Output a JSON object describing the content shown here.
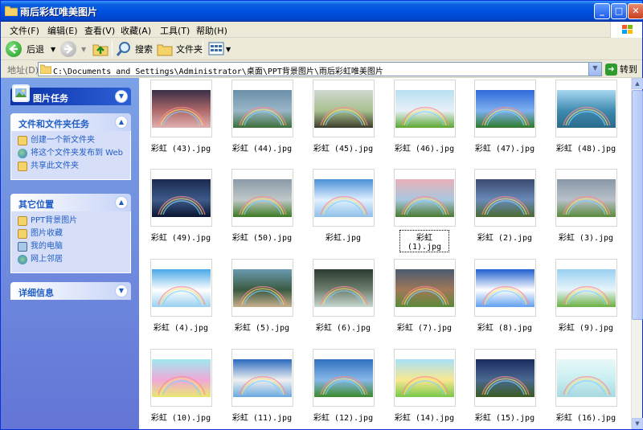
{
  "window": {
    "title": "雨后彩虹唯美图片"
  },
  "window_buttons": {
    "minimize": "_",
    "maximize": "□",
    "close": "✕"
  },
  "menu": [
    "文件(F)",
    "编辑(E)",
    "查看(V)",
    "收藏(A)",
    "工具(T)",
    "帮助(H)"
  ],
  "toolbar": {
    "back": "后退",
    "search": "搜索",
    "folders": "文件夹"
  },
  "address": {
    "label": "地址(D)",
    "path": "C:\\Documents and Settings\\Administrator\\桌面\\PPT背景图片\\雨后彩虹唯美图片",
    "go": "转到"
  },
  "leftpane": {
    "picture_tasks": "图片任务",
    "file_tasks": {
      "title": "文件和文件夹任务",
      "items": [
        "创建一个新文件夹",
        "将这个文件夹发布到 Web",
        "共享此文件夹"
      ]
    },
    "other_places": {
      "title": "其它位置",
      "items": [
        "PPT背景图片",
        "图片收藏",
        "我的电脑",
        "网上邻居"
      ]
    },
    "details": "详细信息"
  },
  "files": [
    {
      "name": "彩虹 (43).jpg",
      "colors": [
        "#3a2e48",
        "#b06a6a",
        "#e0b0b0"
      ]
    },
    {
      "name": "彩虹 (44).jpg",
      "colors": [
        "#6a8fa8",
        "#9ab6c8",
        "#3c6e38"
      ]
    },
    {
      "name": "彩虹 (45).jpg",
      "colors": [
        "#cfd8d0",
        "#a8c090",
        "#3d3d2a"
      ]
    },
    {
      "name": "彩虹 (46).jpg",
      "colors": [
        "#b8e0f0",
        "#e8f0f8",
        "#5aa830"
      ]
    },
    {
      "name": "彩虹 (47).jpg",
      "colors": [
        "#2f6ad8",
        "#7fb0f0",
        "#2e7a28"
      ]
    },
    {
      "name": "彩虹 (48).jpg",
      "colors": [
        "#a8d8f0",
        "#3e8ab0",
        "#2a6a8a"
      ]
    },
    {
      "name": "彩虹 (49).jpg",
      "colors": [
        "#1a2a50",
        "#3d5a8a",
        "#0a1530"
      ]
    },
    {
      "name": "彩虹 (50).jpg",
      "colors": [
        "#8a9aa8",
        "#c0c8c8",
        "#3a7a20"
      ]
    },
    {
      "name": "彩虹.jpg",
      "colors": [
        "#4a90d8",
        "#e0f0ff",
        "#90c0e8"
      ]
    },
    {
      "name": "彩虹 (1).jpg",
      "colors": [
        "#e8b0b8",
        "#a8c8e0",
        "#4a7a30"
      ]
    },
    {
      "name": "彩虹 (2).jpg",
      "colors": [
        "#3a4a70",
        "#6a8ab8",
        "#4a6a30"
      ]
    },
    {
      "name": "彩虹 (3).jpg",
      "colors": [
        "#8898a8",
        "#b8c0c8",
        "#5a8a3a"
      ]
    },
    {
      "name": "彩虹 (4).jpg",
      "colors": [
        "#48a8e8",
        "#ffffff",
        "#9ad0f0"
      ]
    },
    {
      "name": "彩虹 (5).jpg",
      "colors": [
        "#6a9ab0",
        "#3a5a40",
        "#c8b090"
      ]
    },
    {
      "name": "彩虹 (6).jpg",
      "colors": [
        "#2a3a30",
        "#708070",
        "#c8d8d0"
      ]
    },
    {
      "name": "彩虹 (7).jpg",
      "colors": [
        "#4a5a70",
        "#a07858",
        "#5a8a38"
      ]
    },
    {
      "name": "彩虹 (8).jpg",
      "colors": [
        "#2060d0",
        "#ffffff",
        "#60a0f0"
      ]
    },
    {
      "name": "彩虹 (9).jpg",
      "colors": [
        "#98d0f0",
        "#e8f4fb",
        "#6ab040"
      ]
    },
    {
      "name": "彩虹 (10).jpg",
      "colors": [
        "#a0e8f0",
        "#f0a8d8",
        "#e8e870"
      ]
    },
    {
      "name": "彩虹 (11).jpg",
      "colors": [
        "#2a6ac0",
        "#f0f0f0",
        "#68a8e0"
      ]
    },
    {
      "name": "彩虹 (12).jpg",
      "colors": [
        "#3070c0",
        "#88b8e8",
        "#3a8a2a"
      ]
    },
    {
      "name": "彩虹 (14).jpg",
      "colors": [
        "#a8e0f8",
        "#f8e890",
        "#78c848"
      ]
    },
    {
      "name": "彩虹 (15).jpg",
      "colors": [
        "#1a2a60",
        "#4a6a90",
        "#3a5a20"
      ]
    },
    {
      "name": "彩虹 (16).jpg",
      "colors": [
        "#e8f8f8",
        "#c8eef0",
        "#a8d8e0"
      ]
    }
  ],
  "selected_file": "彩虹 (1).jpg"
}
